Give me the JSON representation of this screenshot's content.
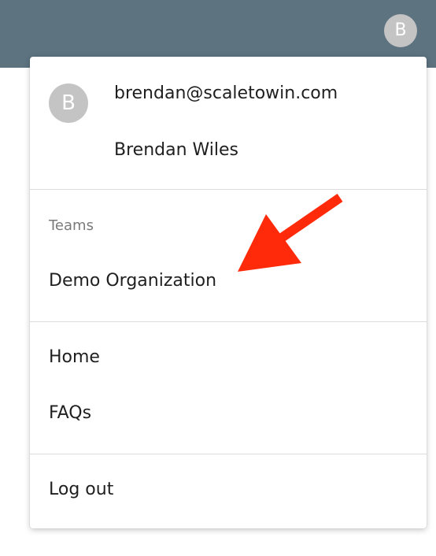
{
  "header": {
    "avatar_initial": "B"
  },
  "menu": {
    "profile": {
      "avatar_initial": "B",
      "email": "brendan@scaletowin.com",
      "name": "Brendan Wiles"
    },
    "teams": {
      "heading": "Teams",
      "items": [
        {
          "label": "Demo Organization"
        }
      ]
    },
    "links": [
      {
        "label": "Home"
      },
      {
        "label": "FAQs"
      }
    ],
    "logout": {
      "label": "Log out"
    }
  },
  "colors": {
    "topbar": "#5d7380",
    "avatar": "#c4c4c4",
    "annotation_arrow": "#ff2a0a"
  }
}
